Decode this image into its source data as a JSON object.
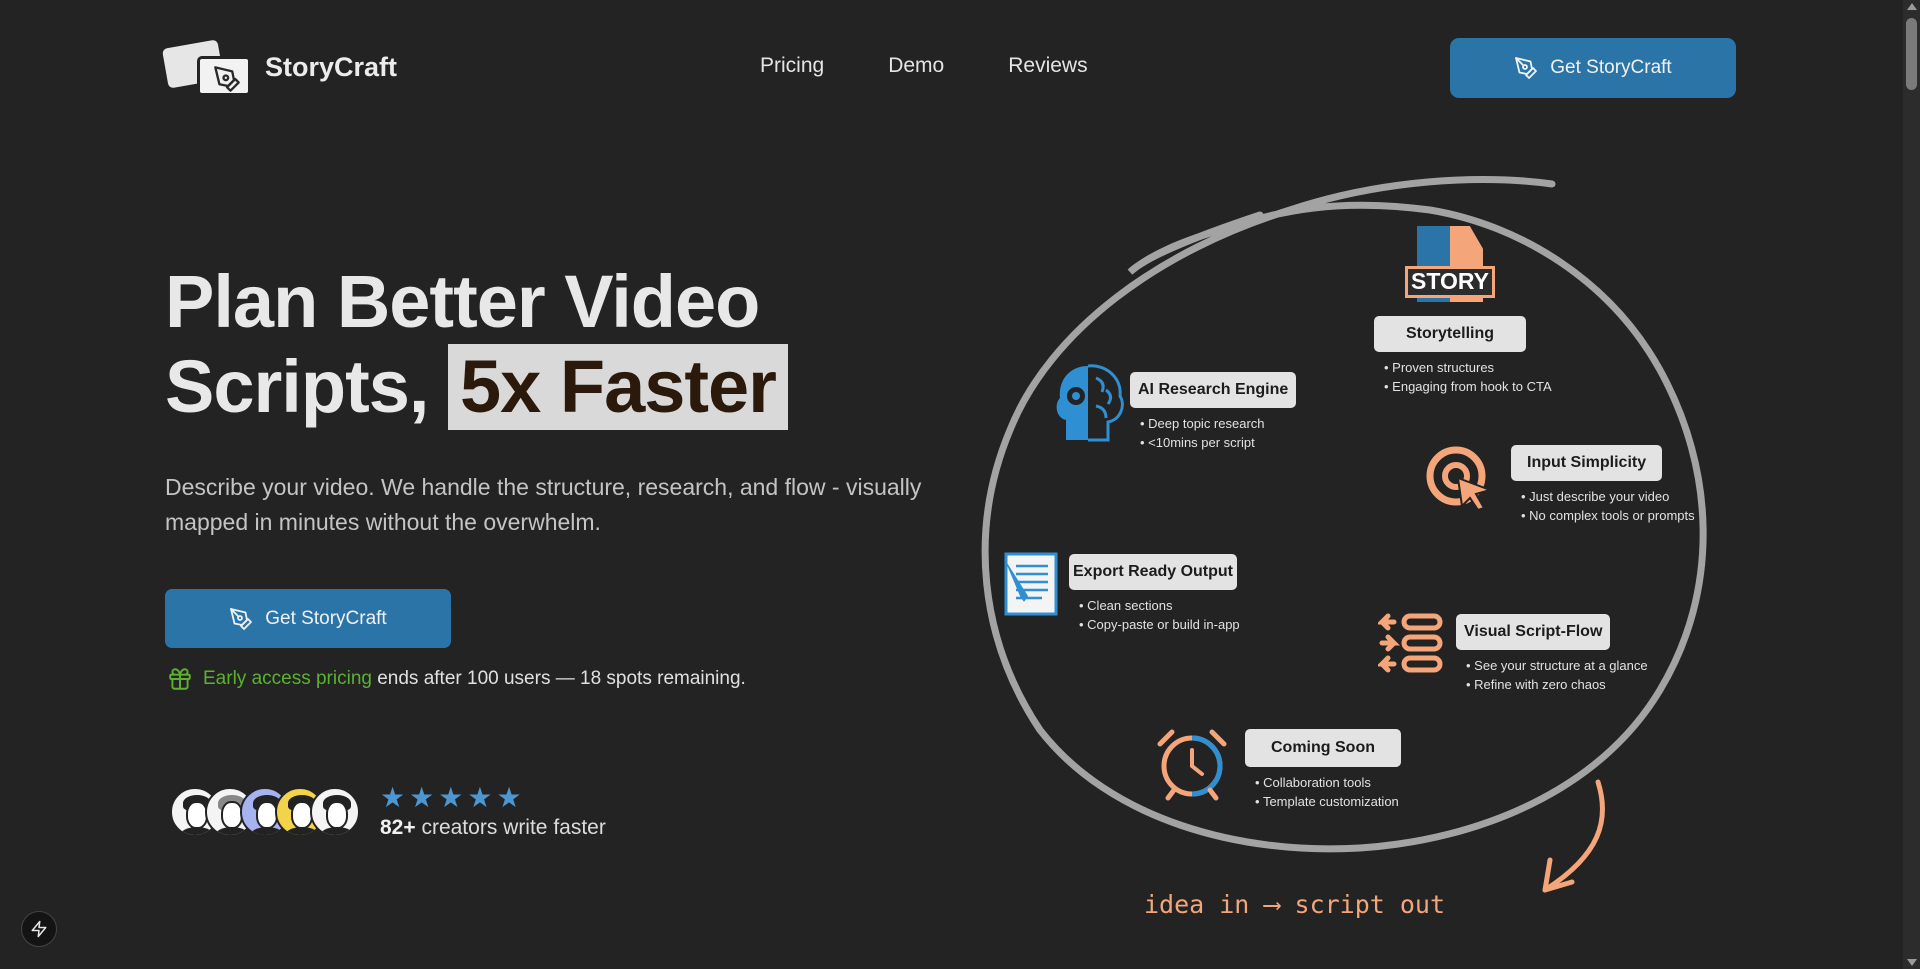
{
  "brand": {
    "name": "StoryCraft"
  },
  "nav": {
    "links": [
      "Pricing",
      "Demo",
      "Reviews"
    ],
    "cta_label": "Get StoryCraft"
  },
  "hero": {
    "title_line1": "Plan Better Video",
    "title_line2_plain": "Scripts, ",
    "title_line2_highlight": "5x Faster",
    "subtitle": "Describe your video. We handle the structure, research, and flow - visually mapped in minutes without the overwhelm.",
    "cta_label": "Get StoryCraft",
    "early_access_highlight": "Early access pricing",
    "early_access_rest": " ends after 100 users — 18 spots remaining."
  },
  "social_proof": {
    "rating_stars": 5,
    "count": "82+",
    "text": " creators write faster"
  },
  "diagram": {
    "story_icon_text": "STORY",
    "features": [
      {
        "label": "Storytelling",
        "bullets": [
          "Proven structures",
          "Engaging from hook to CTA"
        ]
      },
      {
        "label": "AI Research Engine",
        "bullets": [
          "Deep topic research",
          "<10mins per script"
        ]
      },
      {
        "label": "Input Simplicity",
        "bullets": [
          "Just describe your video",
          "No complex tools or prompts"
        ]
      },
      {
        "label": "Export Ready Output",
        "bullets": [
          "Clean sections",
          "Copy-paste or build in-app"
        ]
      },
      {
        "label": "Visual Script-Flow",
        "bullets": [
          "See your structure at a glance",
          "Refine with zero chaos"
        ]
      },
      {
        "label": "Coming Soon",
        "bullets": [
          "Collaboration tools",
          "Template customization"
        ]
      }
    ],
    "tagline": "idea in ⟶ script out"
  },
  "colors": {
    "background": "#232323",
    "primary_button": "#2b74a8",
    "highlight_bg": "#d9d9d9",
    "green": "#5cb130",
    "star": "#4d97d1",
    "accent_orange": "#f4a57a",
    "accent_blue": "#2f8fd3"
  }
}
